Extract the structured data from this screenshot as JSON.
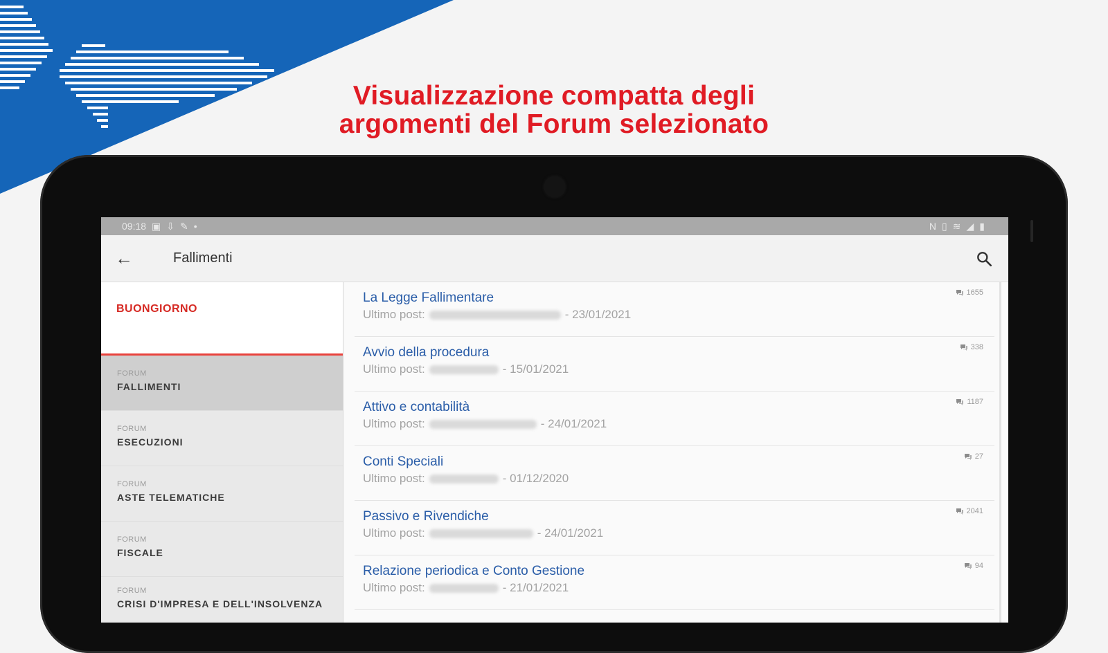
{
  "headline": {
    "line1": "Visualizzazione compatta degli",
    "line2": "argomenti del Forum selezionato"
  },
  "colors": {
    "brand_blue": "#1565b8",
    "headline_red": "#e01b24",
    "link_blue": "#2a5da8",
    "greeting_red": "#d62a24"
  },
  "statusbar": {
    "time": "09:18"
  },
  "appbar": {
    "title": "Fallimenti",
    "back_icon": "arrow-left-icon",
    "search_icon": "search-icon"
  },
  "sidebar": {
    "greeting": "BUONGIORNO",
    "items": [
      {
        "tag": "FORUM",
        "name": "FALLIMENTI",
        "active": true
      },
      {
        "tag": "FORUM",
        "name": "ESECUZIONI",
        "active": false
      },
      {
        "tag": "FORUM",
        "name": "ASTE TELEMATICHE",
        "active": false
      },
      {
        "tag": "FORUM",
        "name": "FISCALE",
        "active": false
      },
      {
        "tag": "FORUM",
        "name": "CRISI D'IMPRESA E DELL'INSOLVENZA",
        "active": false
      }
    ]
  },
  "topics": {
    "meta_prefix": "Ultimo post:",
    "items": [
      {
        "title": "La Legge Fallimentare",
        "date": "- 23/01/2021",
        "count": "1655"
      },
      {
        "title": "Avvio della procedura",
        "date": "- 15/01/2021",
        "count": "338"
      },
      {
        "title": "Attivo e contabilità",
        "date": "- 24/01/2021",
        "count": "1187"
      },
      {
        "title": "Conti Speciali",
        "date": "- 01/12/2020",
        "count": "27"
      },
      {
        "title": "Passivo e Rivendiche",
        "date": "- 24/01/2021",
        "count": "2041"
      },
      {
        "title": "Relazione periodica e Conto Gestione",
        "date": "- 21/01/2021",
        "count": "94"
      }
    ]
  }
}
